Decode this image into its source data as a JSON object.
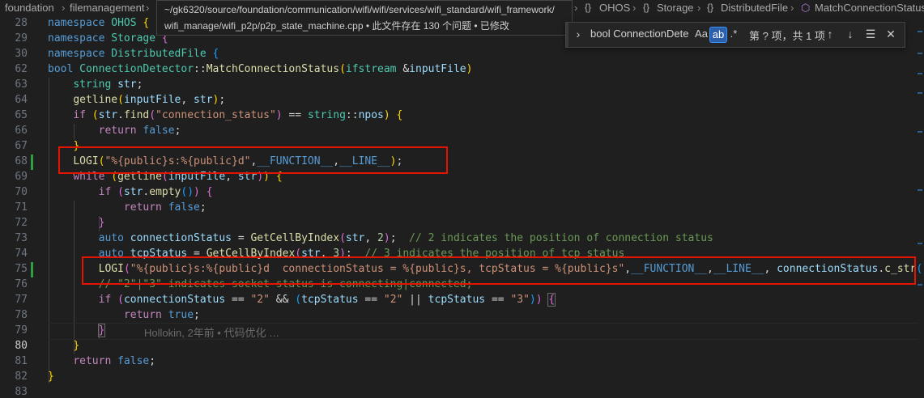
{
  "breadcrumb": {
    "left": [
      "foundation",
      "filemanagement"
    ],
    "right": [
      "OHOS",
      "Storage",
      "DistributedFile",
      "MatchConnectionStatus"
    ]
  },
  "tooltip": {
    "path_line1": "~/gk6320/source/foundation/communication/wifi/wifi/services/wifi_standard/wifi_framework/",
    "path_line2": "wifi_manage/wifi_p2p/p2p_state_machine.cpp • 此文件存在 130 个问题 • 已修改"
  },
  "find_widget": {
    "query": "bool ConnectionDete",
    "match_case_label": "Aa",
    "whole_word_label": "ab",
    "regex_label": ".*",
    "result_text": "第 ? 项，共 1 项"
  },
  "editor": {
    "line_numbers": [
      "28",
      "29",
      "30",
      "62",
      "63",
      "64",
      "65",
      "66",
      "67",
      "68",
      "69",
      "70",
      "71",
      "72",
      "73",
      "74",
      "75",
      "76",
      "77",
      "78",
      "79",
      "80",
      "81",
      "82",
      "83"
    ],
    "active_line": "80",
    "blame_annotation": "Hollokin, 2年前 • 代码优化 …"
  },
  "colors": {
    "background": "#1f1f1f",
    "highlight_box": "#e51400",
    "modified_gutter": "#2ea043"
  }
}
